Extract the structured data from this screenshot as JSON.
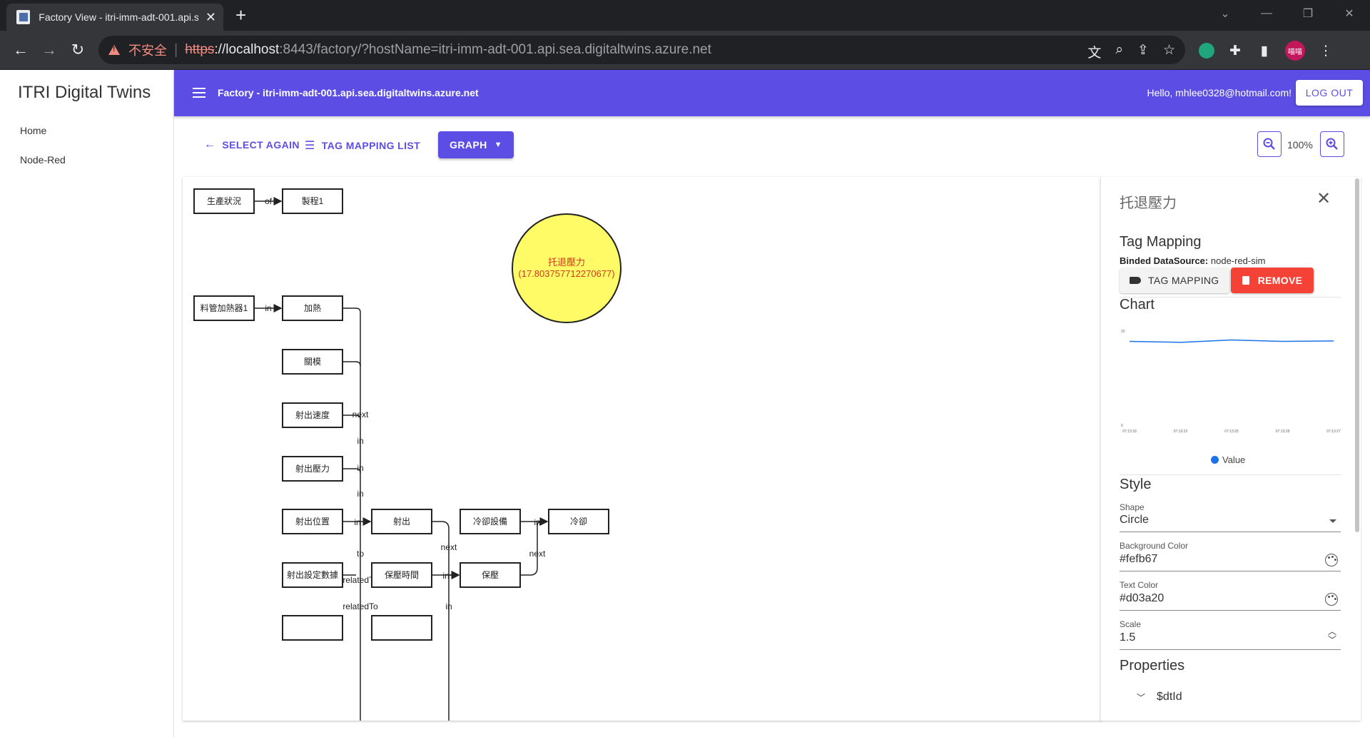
{
  "browser": {
    "tab_title": "Factory View - itri-imm-adt-001.api.s",
    "insecure_label": "不安全",
    "url_scheme": "https",
    "url_host": "://localhost",
    "url_rest": ":8443/factory/?hostName=itri-imm-adt-001.api.sea.digitaltwins.azure.net"
  },
  "sidebar": {
    "brand": "ITRI Digital Twins",
    "items": [
      {
        "label": "Home"
      },
      {
        "label": "Node-Red"
      }
    ]
  },
  "appbar": {
    "title": "Factory - itri-imm-adt-001.api.sea.digitaltwins.azure.net",
    "greeting": "Hello, mhlee0328@hotmail.com!",
    "logout_label": "LOG OUT"
  },
  "toolbar": {
    "select_again": "SELECT AGAIN",
    "tag_mapping_list": "TAG MAPPING LIST",
    "graph": "GRAPH",
    "zoom_level": "100%"
  },
  "graph": {
    "nodes": [
      {
        "id": "n1",
        "label": "生產狀況",
        "col": 0,
        "row": 0
      },
      {
        "id": "n2",
        "label": "製程1",
        "col": 1,
        "row": 0
      },
      {
        "id": "n3",
        "label": "料管加熱器1",
        "col": 0,
        "row": 2
      },
      {
        "id": "n4",
        "label": "加熱",
        "col": 1,
        "row": 2
      },
      {
        "id": "n5",
        "label": "關模",
        "col": 1,
        "row": 3
      },
      {
        "id": "n6",
        "label": "射出速度",
        "col": 1,
        "row": 4
      },
      {
        "id": "n7",
        "label": "射出壓力",
        "col": 1,
        "row": 5
      },
      {
        "id": "n8",
        "label": "射出位置",
        "col": 1,
        "row": 6
      },
      {
        "id": "n9",
        "label": "射出",
        "col": 2,
        "row": 6
      },
      {
        "id": "n10",
        "label": "冷卻設備",
        "col": 3,
        "row": 6
      },
      {
        "id": "n11",
        "label": "冷卻",
        "col": 4,
        "row": 6
      },
      {
        "id": "n12",
        "label": "射出設定數據",
        "col": 1,
        "row": 7
      },
      {
        "id": "n13",
        "label": "保壓時間",
        "col": 2,
        "row": 7
      },
      {
        "id": "n14",
        "label": "保壓",
        "col": 3,
        "row": 7
      }
    ],
    "edge_labels": [
      "of",
      "in",
      "next",
      "in",
      "in",
      "in",
      "in",
      "to",
      "next",
      "in",
      "next",
      "relatedTo",
      "relatedTo",
      "in",
      "in"
    ],
    "circle": {
      "label": "托退壓力",
      "value": "(17.803757712270677)",
      "fill": "#fefb67",
      "text_color": "#d03a20"
    }
  },
  "panel": {
    "title": "托退壓力",
    "tag_mapping_heading": "Tag Mapping",
    "binded_label": "Binded DataSource:",
    "binded_value": "node-red-sim",
    "tag_mapping_btn": "TAG MAPPING",
    "remove_btn": "REMOVE",
    "chart_heading": "Chart",
    "style_heading": "Style",
    "shape_label": "Shape",
    "shape_value": "Circle",
    "bg_label": "Background Color",
    "bg_value": "#fefb67",
    "text_color_label": "Text Color",
    "text_color_value": "#d03a20",
    "scale_label": "Scale",
    "scale_value": "1.5",
    "properties_heading": "Properties",
    "prop_dtid": "$dtId"
  },
  "chart_data": {
    "type": "line",
    "x": [
      "07:13:18",
      "07:13:22",
      "07:13:25",
      "07:13:28",
      "07:13:27"
    ],
    "series": [
      {
        "name": "Value",
        "values": [
          17.8,
          17.6,
          18.1,
          17.8,
          17.9
        ]
      }
    ],
    "ylim": [
      0,
      20
    ],
    "y_ticks": [
      "0",
      "20"
    ],
    "legend": "bottom",
    "color": "#1a73e8"
  }
}
